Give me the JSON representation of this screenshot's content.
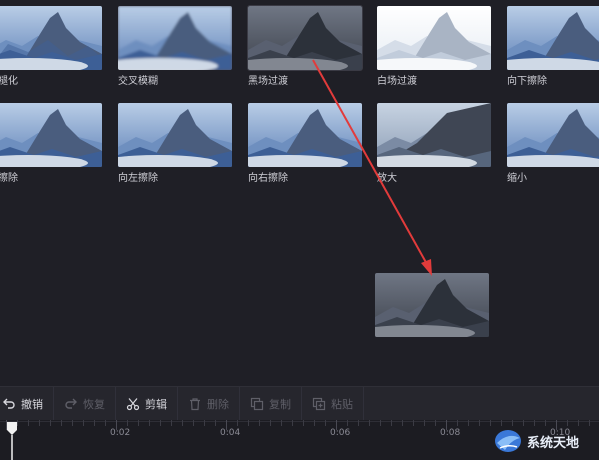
{
  "transitions": [
    {
      "label": "叉褪化",
      "style": "cross"
    },
    {
      "label": "交叉模糊",
      "style": "blur"
    },
    {
      "label": "黑场过渡",
      "style": "dark"
    },
    {
      "label": "白场过渡",
      "style": "white"
    },
    {
      "label": "向下擦除",
      "style": "normal"
    },
    {
      "label": "上擦除",
      "style": "normal"
    },
    {
      "label": "向左擦除",
      "style": "normal"
    },
    {
      "label": "向右擦除",
      "style": "normal"
    },
    {
      "label": "放大",
      "style": "zoom"
    },
    {
      "label": "缩小",
      "style": "normal"
    }
  ],
  "toolbar": {
    "undo": "撤销",
    "redo": "恢复",
    "cut": "剪辑",
    "delete": "删除",
    "copy": "复制",
    "paste": "粘贴"
  },
  "timeline": {
    "labels": [
      "0:02",
      "0:04",
      "0:06",
      "0:08",
      "0:10"
    ]
  },
  "watermark": {
    "text": "系统天地"
  },
  "colors": {
    "accent_arrow": "#e23b3b",
    "background": "#1f1f26"
  }
}
